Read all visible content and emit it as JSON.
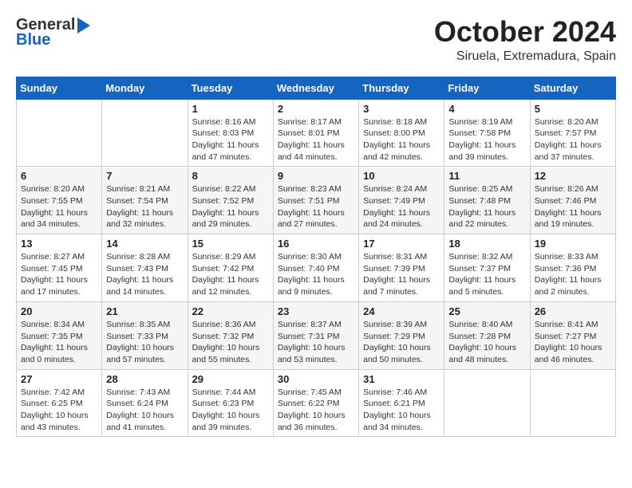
{
  "header": {
    "logo_line1": "General",
    "logo_line2": "Blue",
    "month_title": "October 2024",
    "location": "Siruela, Extremadura, Spain"
  },
  "calendar": {
    "days_of_week": [
      "Sunday",
      "Monday",
      "Tuesday",
      "Wednesday",
      "Thursday",
      "Friday",
      "Saturday"
    ],
    "weeks": [
      [
        {
          "day": "",
          "info": ""
        },
        {
          "day": "",
          "info": ""
        },
        {
          "day": "1",
          "info": "Sunrise: 8:16 AM\nSunset: 8:03 PM\nDaylight: 11 hours and 47 minutes."
        },
        {
          "day": "2",
          "info": "Sunrise: 8:17 AM\nSunset: 8:01 PM\nDaylight: 11 hours and 44 minutes."
        },
        {
          "day": "3",
          "info": "Sunrise: 8:18 AM\nSunset: 8:00 PM\nDaylight: 11 hours and 42 minutes."
        },
        {
          "day": "4",
          "info": "Sunrise: 8:19 AM\nSunset: 7:58 PM\nDaylight: 11 hours and 39 minutes."
        },
        {
          "day": "5",
          "info": "Sunrise: 8:20 AM\nSunset: 7:57 PM\nDaylight: 11 hours and 37 minutes."
        }
      ],
      [
        {
          "day": "6",
          "info": "Sunrise: 8:20 AM\nSunset: 7:55 PM\nDaylight: 11 hours and 34 minutes."
        },
        {
          "day": "7",
          "info": "Sunrise: 8:21 AM\nSunset: 7:54 PM\nDaylight: 11 hours and 32 minutes."
        },
        {
          "day": "8",
          "info": "Sunrise: 8:22 AM\nSunset: 7:52 PM\nDaylight: 11 hours and 29 minutes."
        },
        {
          "day": "9",
          "info": "Sunrise: 8:23 AM\nSunset: 7:51 PM\nDaylight: 11 hours and 27 minutes."
        },
        {
          "day": "10",
          "info": "Sunrise: 8:24 AM\nSunset: 7:49 PM\nDaylight: 11 hours and 24 minutes."
        },
        {
          "day": "11",
          "info": "Sunrise: 8:25 AM\nSunset: 7:48 PM\nDaylight: 11 hours and 22 minutes."
        },
        {
          "day": "12",
          "info": "Sunrise: 8:26 AM\nSunset: 7:46 PM\nDaylight: 11 hours and 19 minutes."
        }
      ],
      [
        {
          "day": "13",
          "info": "Sunrise: 8:27 AM\nSunset: 7:45 PM\nDaylight: 11 hours and 17 minutes."
        },
        {
          "day": "14",
          "info": "Sunrise: 8:28 AM\nSunset: 7:43 PM\nDaylight: 11 hours and 14 minutes."
        },
        {
          "day": "15",
          "info": "Sunrise: 8:29 AM\nSunset: 7:42 PM\nDaylight: 11 hours and 12 minutes."
        },
        {
          "day": "16",
          "info": "Sunrise: 8:30 AM\nSunset: 7:40 PM\nDaylight: 11 hours and 9 minutes."
        },
        {
          "day": "17",
          "info": "Sunrise: 8:31 AM\nSunset: 7:39 PM\nDaylight: 11 hours and 7 minutes."
        },
        {
          "day": "18",
          "info": "Sunrise: 8:32 AM\nSunset: 7:37 PM\nDaylight: 11 hours and 5 minutes."
        },
        {
          "day": "19",
          "info": "Sunrise: 8:33 AM\nSunset: 7:36 PM\nDaylight: 11 hours and 2 minutes."
        }
      ],
      [
        {
          "day": "20",
          "info": "Sunrise: 8:34 AM\nSunset: 7:35 PM\nDaylight: 11 hours and 0 minutes."
        },
        {
          "day": "21",
          "info": "Sunrise: 8:35 AM\nSunset: 7:33 PM\nDaylight: 10 hours and 57 minutes."
        },
        {
          "day": "22",
          "info": "Sunrise: 8:36 AM\nSunset: 7:32 PM\nDaylight: 10 hours and 55 minutes."
        },
        {
          "day": "23",
          "info": "Sunrise: 8:37 AM\nSunset: 7:31 PM\nDaylight: 10 hours and 53 minutes."
        },
        {
          "day": "24",
          "info": "Sunrise: 8:39 AM\nSunset: 7:29 PM\nDaylight: 10 hours and 50 minutes."
        },
        {
          "day": "25",
          "info": "Sunrise: 8:40 AM\nSunset: 7:28 PM\nDaylight: 10 hours and 48 minutes."
        },
        {
          "day": "26",
          "info": "Sunrise: 8:41 AM\nSunset: 7:27 PM\nDaylight: 10 hours and 46 minutes."
        }
      ],
      [
        {
          "day": "27",
          "info": "Sunrise: 7:42 AM\nSunset: 6:25 PM\nDaylight: 10 hours and 43 minutes."
        },
        {
          "day": "28",
          "info": "Sunrise: 7:43 AM\nSunset: 6:24 PM\nDaylight: 10 hours and 41 minutes."
        },
        {
          "day": "29",
          "info": "Sunrise: 7:44 AM\nSunset: 6:23 PM\nDaylight: 10 hours and 39 minutes."
        },
        {
          "day": "30",
          "info": "Sunrise: 7:45 AM\nSunset: 6:22 PM\nDaylight: 10 hours and 36 minutes."
        },
        {
          "day": "31",
          "info": "Sunrise: 7:46 AM\nSunset: 6:21 PM\nDaylight: 10 hours and 34 minutes."
        },
        {
          "day": "",
          "info": ""
        },
        {
          "day": "",
          "info": ""
        }
      ]
    ]
  }
}
